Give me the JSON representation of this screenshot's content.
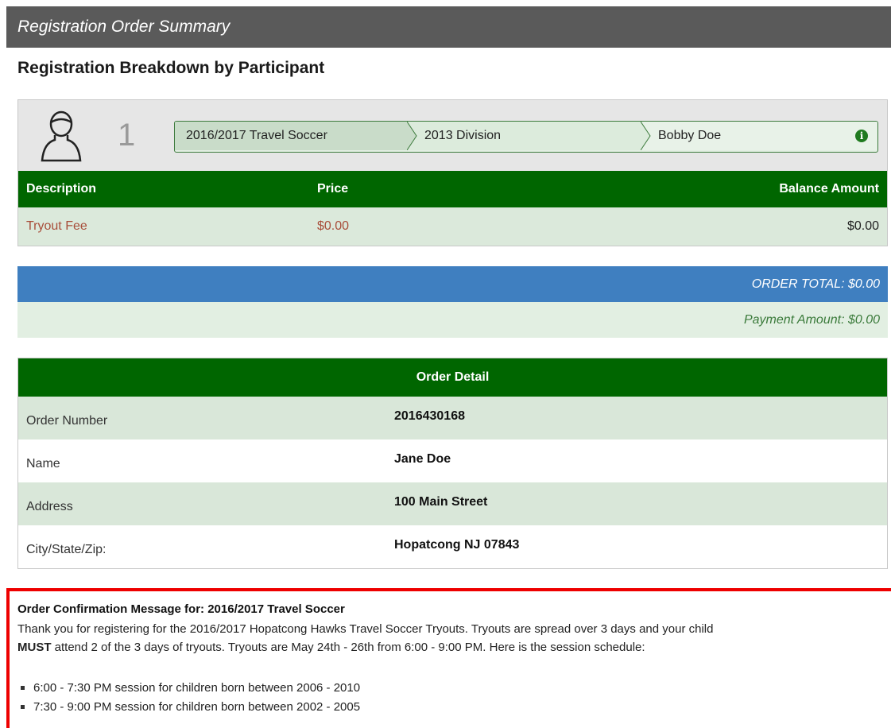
{
  "header": {
    "title": "Registration Order Summary"
  },
  "breakdown_title": "Registration Breakdown by Participant",
  "participant": {
    "number": "1",
    "crumbs": [
      "2016/2017 Travel Soccer",
      "2013 Division",
      "Bobby Doe"
    ],
    "info_icon_glyph": "i"
  },
  "fee_table": {
    "headers": {
      "description": "Description",
      "price": "Price",
      "balance": "Balance Amount"
    },
    "rows": [
      {
        "description": "Tryout Fee",
        "price": "$0.00",
        "balance": "$0.00"
      }
    ]
  },
  "totals": {
    "order_total": "ORDER TOTAL: $0.00",
    "payment_amount": "Payment Amount: $0.00"
  },
  "order_detail": {
    "title": "Order Detail",
    "rows": [
      {
        "label": "Order Number",
        "value": "2016430168"
      },
      {
        "label": "Name",
        "value": "Jane Doe"
      },
      {
        "label": "Address",
        "value": "100 Main Street"
      },
      {
        "label": "City/State/Zip:",
        "value": "Hopatcong NJ 07843"
      }
    ]
  },
  "confirmation": {
    "title": "Order Confirmation Message for: 2016/2017 Travel Soccer",
    "line1": "Thank you for registering for the 2016/2017 Hopatcong Hawks Travel Soccer Tryouts.  Tryouts are spread over 3 days and your child",
    "must": "MUST",
    "line2": " attend 2 of the 3 days of tryouts.  Tryouts are May 24th - 26th from 6:00 - 9:00 PM.  Here is the session schedule:",
    "sessions": [
      "6:00 - 7:30 PM session for children born between 2006 - 2010",
      "7:30 - 9:00 PM session for children born between 2002 - 2005"
    ]
  },
  "colors": {
    "header_bg": "#5a5a5a",
    "green": "#006600",
    "blue": "#3f7fc0",
    "highlight_border": "#ee0000",
    "fee_text": "#a84e3a"
  },
  "icons": {
    "avatar": "user-avatar-icon",
    "info": "info-icon"
  }
}
